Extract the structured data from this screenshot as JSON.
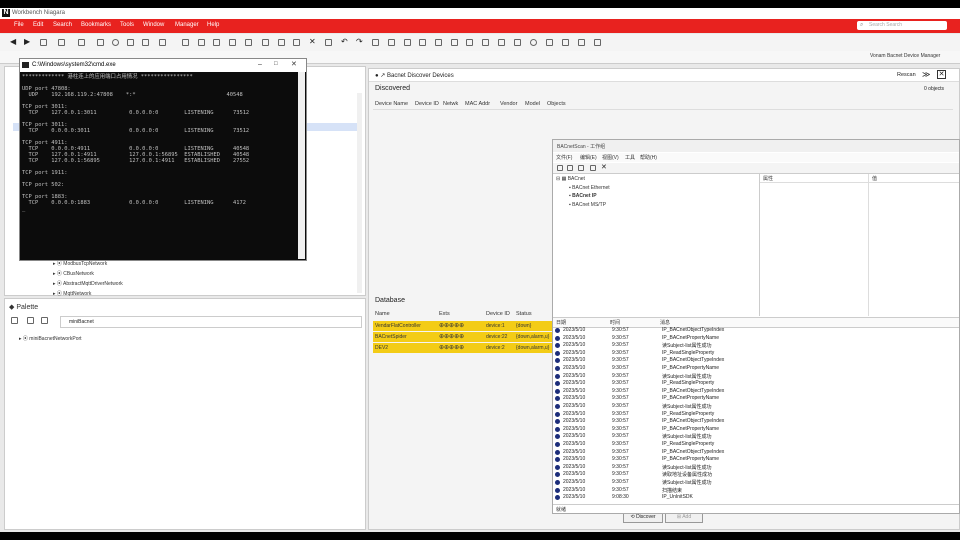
{
  "app": {
    "title": "Workbench Niagara",
    "logo": "N"
  },
  "menu": [
    "File",
    "Edit",
    "Search",
    "Bookmarks",
    "Tools",
    "Window",
    "Manager",
    "Help"
  ],
  "search_placeholder": "Search Search",
  "toolbar2": {
    "manager_label": "Vonam Bacnet Device Manager"
  },
  "nav_tree": {
    "items": [
      "ModbusTcpNetwork",
      "CBusNetwork",
      "AbstractMqttDriverNetwork",
      "MqttNetwork"
    ]
  },
  "palette": {
    "title": "Palette",
    "field_value": "miniBacnet",
    "tree_item": "miniBacnetNetworkPort"
  },
  "cmd": {
    "title": "C:\\Windows\\system32\\cmd.exe",
    "lines": [
      "************* 港柱连上的应用端口占用情况 ****************",
      "",
      "UDP port 47808:",
      "  UDP    192.168.119.2:47808    *:*                            40548",
      "",
      "TCP port 3011:",
      "  TCP    127.0.0.1:3011          0.0.0.0:0        LISTENING      73512",
      "",
      "TCP port 3011:",
      "  TCP    0.0.0.0:3011            0.0.0.0:0        LISTENING      73512",
      "",
      "TCP port 4911:",
      "  TCP    0.0.0.0:4911            0.0.0.0:0        LISTENING      40548",
      "  TCP    127.0.0.1:4911          127.0.0.1:56895  ESTABLISHED    40548",
      "  TCP    127.0.0.1:56895         127.0.0.1:4911   ESTABLISHED    27552",
      "",
      "TCP port 1911:",
      "",
      "TCP port 502:",
      "",
      "TCP port 1883:",
      "  TCP    0.0.0.0:1883            0.0.0.0:0        LISTENING      4172",
      "_"
    ]
  },
  "discover": {
    "header": "Bacnet Discover Devices",
    "status": "Rescan",
    "section": "Discovered",
    "count": "0 objects",
    "columns": [
      "Device Name",
      "Device ID",
      "Netwk",
      "MAC Addr",
      "Vendor",
      "Model",
      "Objects"
    ]
  },
  "database": {
    "title": "Database",
    "columns": [
      "Name",
      "Exts",
      "Device ID",
      "Status"
    ],
    "rows": [
      {
        "name": "VendarFlatController",
        "id": "device:1",
        "status": "{down}"
      },
      {
        "name": "BACnetSpider",
        "id": "device:22",
        "status": "{down,alarm,u}"
      },
      {
        "name": "DEV2",
        "id": "device:2",
        "status": "{down,alarm,u}"
      }
    ]
  },
  "scan": {
    "title": "BACnetScan - 工作组",
    "menu": [
      "文件(F)",
      "编辑(E)",
      "视图(V)",
      "工具",
      "帮助(H)"
    ],
    "tree": {
      "root": "BACnet",
      "children": [
        "BACnet Ethernet",
        "BACnet IP",
        "BACnet MS/TP"
      ]
    },
    "prop_headers": [
      "属性",
      "值"
    ],
    "log_headers": [
      "日期",
      "时间",
      "消息"
    ],
    "log": [
      [
        "2023/5/10",
        "9:30:57",
        "IP_BACnetObjectTypeIndex"
      ],
      [
        "2023/5/10",
        "9:30:57",
        "IP_BACnetPropertyName"
      ],
      [
        "2023/5/10",
        "9:30:57",
        "读Subject-list属性成功"
      ],
      [
        "2023/5/10",
        "9:30:57",
        "IP_ReadSingleProperty"
      ],
      [
        "2023/5/10",
        "9:30:57",
        "IP_BACnetObjectTypeIndex"
      ],
      [
        "2023/5/10",
        "9:30:57",
        "IP_BACnetPropertyName"
      ],
      [
        "2023/5/10",
        "9:30:57",
        "读Subject-list属性成功"
      ],
      [
        "2023/5/10",
        "9:30:57",
        "IP_ReadSingleProperty"
      ],
      [
        "2023/5/10",
        "9:30:57",
        "IP_BACnetObjectTypeIndex"
      ],
      [
        "2023/5/10",
        "9:30:57",
        "IP_BACnetPropertyName"
      ],
      [
        "2023/5/10",
        "9:30:57",
        "读Subject-list属性成功"
      ],
      [
        "2023/5/10",
        "9:30:57",
        "IP_ReadSingleProperty"
      ],
      [
        "2023/5/10",
        "9:30:57",
        "IP_BACnetObjectTypeIndex"
      ],
      [
        "2023/5/10",
        "9:30:57",
        "IP_BACnetPropertyName"
      ],
      [
        "2023/5/10",
        "9:30:57",
        "读Subject-list属性成功"
      ],
      [
        "2023/5/10",
        "9:30:57",
        "IP_ReadSingleProperty"
      ],
      [
        "2023/5/10",
        "9:30:57",
        "IP_BACnetObjectTypeIndex"
      ],
      [
        "2023/5/10",
        "9:30:57",
        "IP_BACnetPropertyName"
      ],
      [
        "2023/5/10",
        "9:30:57",
        "读Subject-list属性成功"
      ],
      [
        "2023/5/10",
        "9:30:57",
        "读取地址设备属性成功"
      ],
      [
        "2023/5/10",
        "9:30:57",
        "读Subject-list属性成功"
      ],
      [
        "2023/5/10",
        "9:30:57",
        "扫描结束"
      ],
      [
        "2023/5/10",
        "9:08:30",
        "IP_UnInitSDK"
      ]
    ],
    "footer_label": "就绪",
    "btn_discover": "Discover",
    "btn_add": "Add"
  },
  "colors": {
    "brand": "#e8221f",
    "highlight": "#f3cc16",
    "log_icon": "#1c2d7a"
  }
}
